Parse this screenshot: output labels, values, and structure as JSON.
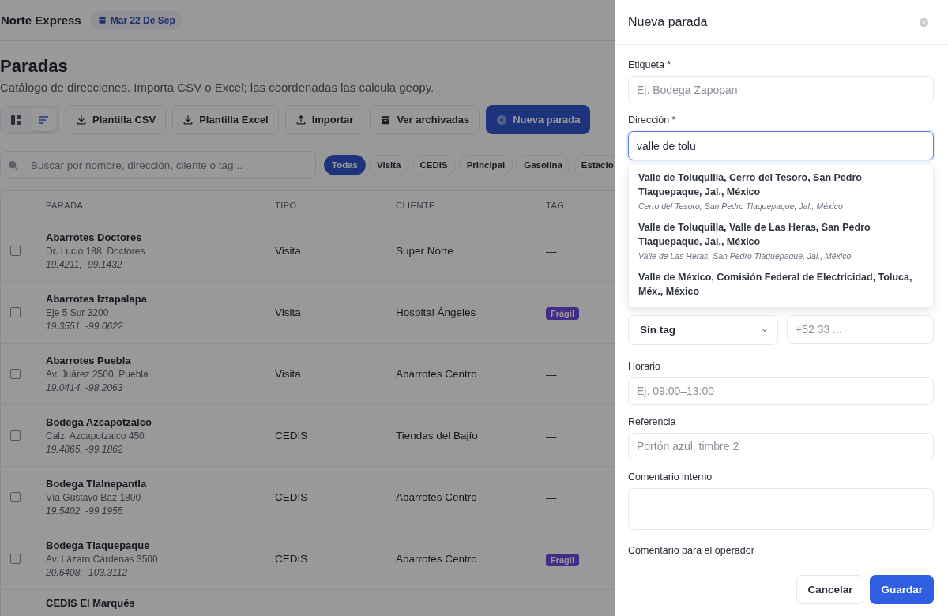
{
  "app": {
    "brand": "Norte Express",
    "date": "Mar 22 De Sep"
  },
  "page": {
    "title": "Paradas",
    "subtitle": "Catálogo de direcciones. Importa CSV o Excel; las coordenadas las calcula geopy."
  },
  "view_toggle": [
    {
      "kind": "grid",
      "selected": false
    },
    {
      "kind": "list",
      "selected": true
    }
  ],
  "toolbar": [
    {
      "label": "Plantilla CSV",
      "kind": "download"
    },
    {
      "label": "Plantilla Excel",
      "kind": "download"
    },
    {
      "label": "Importar",
      "kind": "upload"
    },
    {
      "label": "Ver archivadas",
      "kind": "archive"
    },
    {
      "label": "Nueva parada",
      "kind": "create"
    }
  ],
  "search": {
    "placeholder": "Buscar por nombre, dirección, cliente o tag..."
  },
  "filters": [
    {
      "label": "Todas",
      "selected": true
    },
    {
      "label": "Visita",
      "selected": false
    },
    {
      "label": "CEDIS",
      "selected": false
    },
    {
      "label": "Principal",
      "selected": false
    },
    {
      "label": "Gasolina",
      "selected": false
    },
    {
      "label": "Estacio",
      "selected": false
    }
  ],
  "table": {
    "columns": [
      "PARADA",
      "TIPO",
      "CLIENTE",
      "TAG"
    ],
    "rows": [
      {
        "checked": false,
        "name": "Abarrotes Doctores",
        "address": "Dr. Lucio 188, Doctores",
        "coords": "19.4211, -99.1432",
        "type": "Visita",
        "client": "Super Norte",
        "tag": {
          "kind": "none",
          "label": "—"
        }
      },
      {
        "checked": false,
        "name": "Abarrotes Iztapalapa",
        "address": "Eje 5 Sur 3200",
        "coords": "19.3551, -99.0622",
        "type": "Visita",
        "client": "Hospital Ángeles",
        "tag": {
          "kind": "badge",
          "label": "Frágil"
        }
      },
      {
        "checked": false,
        "name": "Abarrotes Puebla",
        "address": "Av. Juárez 2500, Puebla",
        "coords": "19.0414, -98.2063",
        "type": "Visita",
        "client": "Abarrotes Centro",
        "tag": {
          "kind": "none",
          "label": "—"
        }
      },
      {
        "checked": false,
        "name": "Bodega Azcapotzalco",
        "address": "Calz. Azcapotzalco 450",
        "coords": "19.4865, -99.1862",
        "type": "CEDIS",
        "client": "Tiendas del Bajío",
        "tag": {
          "kind": "none",
          "label": "—"
        }
      },
      {
        "checked": false,
        "name": "Bodega Tlalnepantla",
        "address": "Vía Gustavo Baz 1800",
        "coords": "19.5402, -99.1955",
        "type": "CEDIS",
        "client": "Abarrotes Centro",
        "tag": {
          "kind": "none",
          "label": "—"
        }
      },
      {
        "checked": false,
        "name": "Bodega Tlaquepaque",
        "address": "Av. Lázaro Cárdenas 3500",
        "coords": "20.6408, -103.3112",
        "type": "CEDIS",
        "client": "Abarrotes Centro",
        "tag": {
          "kind": "badge",
          "label": "Frágil"
        }
      },
      {
        "name": "CEDIS El Marqués"
      }
    ]
  },
  "drawer": {
    "title": "Nueva parada",
    "fields": [
      {
        "kind": "input",
        "label": "Etiqueta *",
        "placeholder": "Ej. Bodega Zapopan"
      },
      {
        "kind": "autocomplete",
        "label": "Dirección *",
        "value": "valle de tolu",
        "focused": true,
        "suggestions": [
          {
            "title": "Valle de Toluquilla, Cerro del Tesoro, San Pedro Tlaquepaque, Jal., México",
            "subtitle": "Cerro del Tesoro, San Pedro Tlaquepaque, Jal., México"
          },
          {
            "title": "Valle de Toluquilla, Valle de Las Heras, San Pedro Tlaquepaque, Jal., México",
            "subtitle": "Valle de Las Heras, San Pedro Tlaquepaque, Jal., México"
          },
          {
            "title": "Valle de México, Comisión Federal de Electricidad, Toluca, Méx., México"
          }
        ]
      },
      {
        "kind": "pair",
        "select": "Sin tag",
        "placeholder": "+52 33 ..."
      },
      {
        "kind": "input",
        "label": "Horario",
        "placeholder": "Ej. 09:00–13:00"
      },
      {
        "kind": "input",
        "label": "Referencia",
        "placeholder": "Portón azul, timbre 2"
      },
      {
        "kind": "textarea",
        "label": "Comentario interno"
      },
      {
        "kind": "label",
        "label": "Comentario para el operador"
      }
    ],
    "buttons": [
      {
        "label": "Cancelar",
        "kind": "secondary"
      },
      {
        "label": "Guardar",
        "kind": "primary"
      }
    ]
  }
}
